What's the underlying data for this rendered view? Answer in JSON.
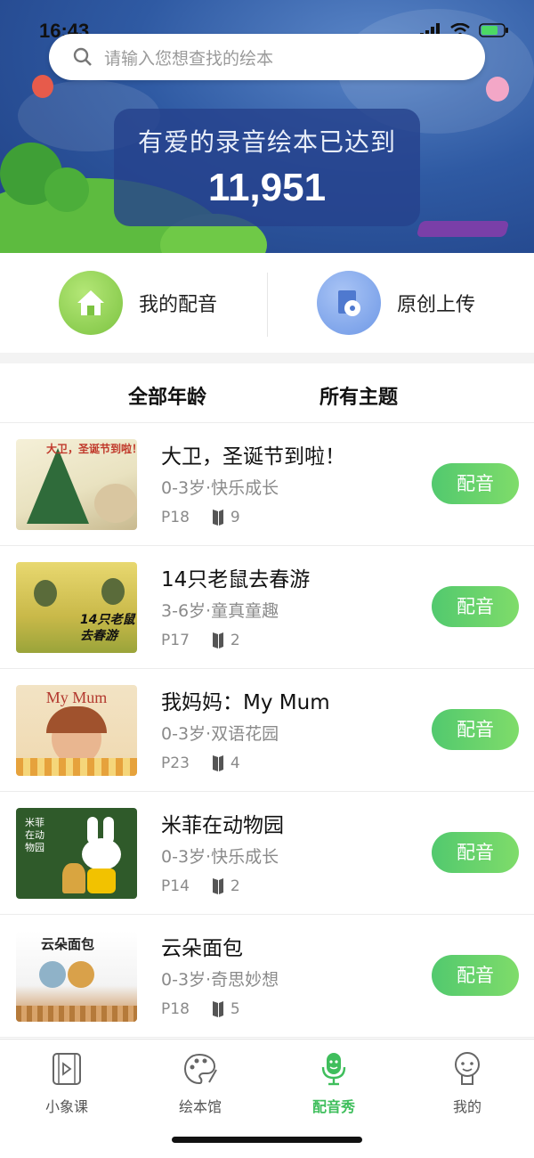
{
  "status": {
    "time": "16:43"
  },
  "search": {
    "placeholder": "请输入您想查找的绘本"
  },
  "banner": {
    "caption": "有爱的录音绘本已达到",
    "count": "11,951"
  },
  "quick_actions": [
    {
      "label": "我的配音",
      "icon": "home-icon",
      "color": "#8fd14f"
    },
    {
      "label": "原创上传",
      "icon": "disc-upload-icon",
      "color": "#7aa3ea"
    }
  ],
  "filters": {
    "age": "全部年龄",
    "theme": "所有主题"
  },
  "books": [
    {
      "title": "大卫，圣诞节到啦！",
      "meta": "0-3岁·快乐成长",
      "pages": "P18",
      "count": "9",
      "cover_text": "大卫，圣诞节到啦！"
    },
    {
      "title": "14只老鼠去春游",
      "meta": "3-6岁·童真童趣",
      "pages": "P17",
      "count": "2",
      "cover_text": "14只老鼠去春游"
    },
    {
      "title": "我妈妈：My Mum",
      "meta": "0-3岁·双语花园",
      "pages": "P23",
      "count": "4",
      "cover_text": "My Mum"
    },
    {
      "title": "米菲在动物园",
      "meta": "0-3岁·快乐成长",
      "pages": "P14",
      "count": "2",
      "cover_text": "米菲在动物园"
    },
    {
      "title": "云朵面包",
      "meta": "0-3岁·奇思妙想",
      "pages": "P18",
      "count": "5",
      "cover_text": "云朵面包"
    }
  ],
  "dub_label": "配音",
  "tabs": [
    {
      "label": "小象课",
      "icon": "video-icon"
    },
    {
      "label": "绘本馆",
      "icon": "palette-icon"
    },
    {
      "label": "配音秀",
      "icon": "microphone-icon",
      "active": true
    },
    {
      "label": "我的",
      "icon": "profile-icon"
    }
  ],
  "colors": {
    "accent": "#3fbe5c",
    "banner": "#2f5aa3"
  }
}
